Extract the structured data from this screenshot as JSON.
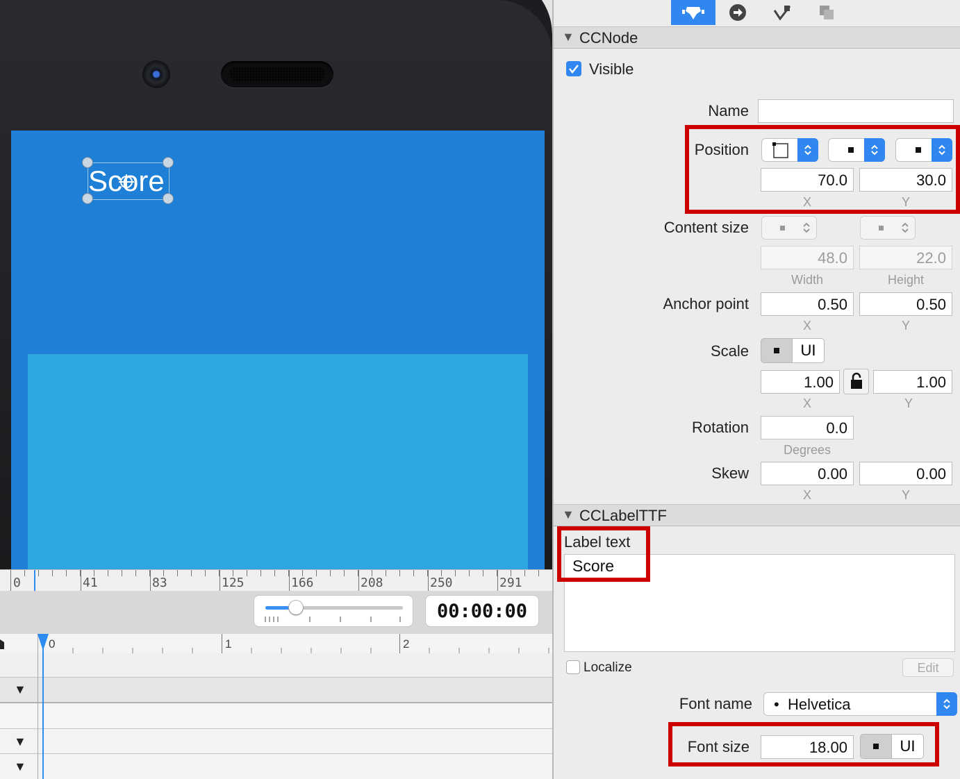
{
  "canvas": {
    "label_text": "Score",
    "ruler_labels": [
      "0",
      "41",
      "83",
      "125",
      "166",
      "208",
      "250",
      "291"
    ]
  },
  "timeline": {
    "timecode": "00:00:00",
    "ruler_labels": [
      "0",
      "1",
      "2"
    ],
    "zoom_level": 0.22
  },
  "inspector": {
    "tabs": [
      {
        "name": "properties",
        "icon": "properties-icon",
        "active": true
      },
      {
        "name": "code-connections",
        "icon": "arrow-circle-icon",
        "active": false
      },
      {
        "name": "physics",
        "icon": "physics-icon",
        "active": false
      },
      {
        "name": "templates",
        "icon": "templates-icon",
        "active": false
      }
    ],
    "ccnode": {
      "title": "CCNode",
      "visible_label": "Visible",
      "visible_checked": true,
      "name_label": "Name",
      "name_value": "",
      "position_label": "Position",
      "position_x": "70.0",
      "position_y": "30.0",
      "x_label": "X",
      "y_label": "Y",
      "content_size_label": "Content size",
      "width_value": "48.0",
      "height_value": "22.0",
      "width_label": "Width",
      "height_label": "Height",
      "anchor_label": "Anchor point",
      "anchor_x": "0.50",
      "anchor_y": "0.50",
      "scale_label": "Scale",
      "scale_ui_label": "UI",
      "scale_x": "1.00",
      "scale_y": "1.00",
      "rotation_label": "Rotation",
      "rotation_value": "0.0",
      "degrees_label": "Degrees",
      "skew_label": "Skew",
      "skew_x": "0.00",
      "skew_y": "0.00"
    },
    "cclabel": {
      "title": "CCLabelTTF",
      "label_text_label": "Label text",
      "label_text_value": "Score",
      "localize_label": "Localize",
      "localize_checked": false,
      "edit_label": "Edit",
      "font_name_label": "Font name",
      "font_name_value": "Helvetica",
      "font_size_label": "Font size",
      "font_size_value": "18.00",
      "font_size_ui_label": "UI"
    }
  },
  "colors": {
    "accent": "#2f87ef",
    "highlight_box": "#cc0000",
    "scene_background": "#1d80d6",
    "scene_panel": "#2ea6e0"
  }
}
